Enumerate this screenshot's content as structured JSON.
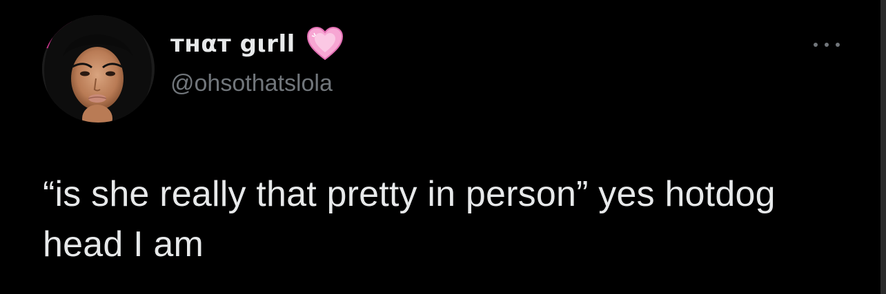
{
  "tweet": {
    "display_name": "тнαт gιrll",
    "handle": "@ohsothatslola",
    "badge_icon": "heart-emoji-icon",
    "text": "“is she really that pretty in person” yes hotdog head I am",
    "more_icon": "more-options-icon"
  },
  "colors": {
    "background": "#000000",
    "primary_text": "#e7e9ea",
    "secondary_text": "#71767b",
    "heart_pink": "#f79bcf"
  }
}
